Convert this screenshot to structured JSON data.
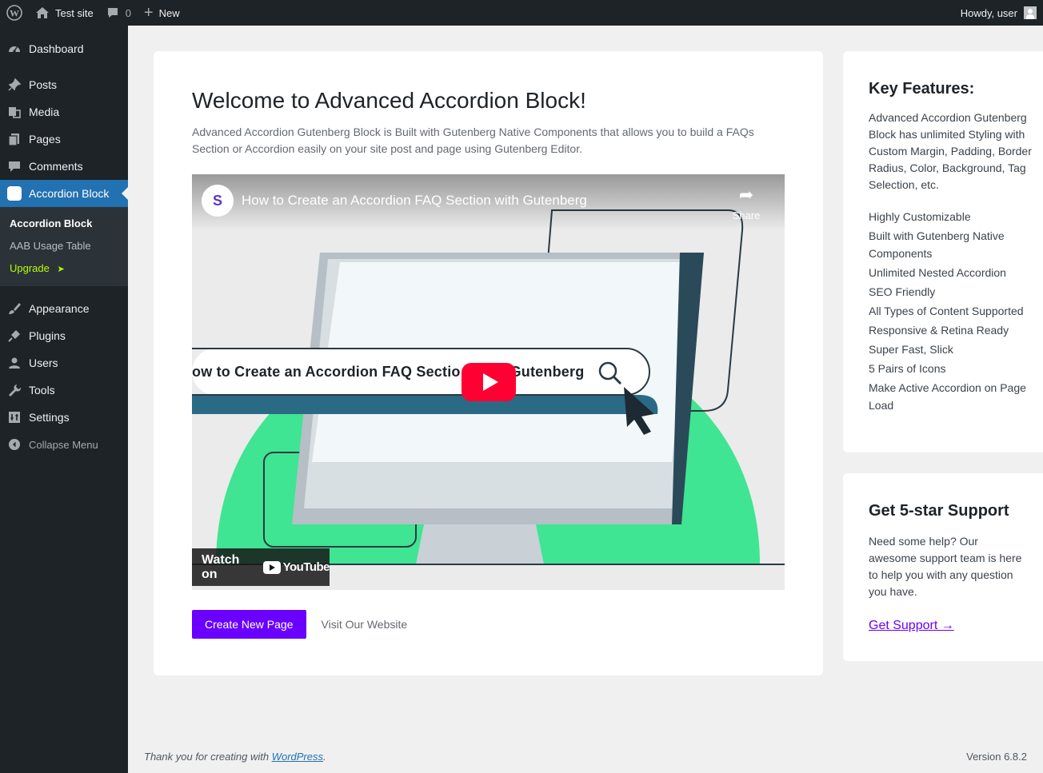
{
  "adminbar": {
    "site_name": "Test site",
    "comments_count": "0",
    "new_label": "New",
    "howdy": "Howdy, user"
  },
  "sidebar": {
    "items": [
      {
        "label": "Dashboard",
        "icon": "dashboard-icon"
      },
      {
        "label": "Posts",
        "icon": "pin-icon"
      },
      {
        "label": "Media",
        "icon": "media-icon"
      },
      {
        "label": "Pages",
        "icon": "pages-icon"
      },
      {
        "label": "Comments",
        "icon": "comment-icon"
      },
      {
        "label": "Accordion Block",
        "icon": "accordion-block-icon"
      },
      {
        "label": "Appearance",
        "icon": "brush-icon"
      },
      {
        "label": "Plugins",
        "icon": "plugin-icon"
      },
      {
        "label": "Users",
        "icon": "user-icon"
      },
      {
        "label": "Tools",
        "icon": "wrench-icon"
      },
      {
        "label": "Settings",
        "icon": "settings-icon"
      }
    ],
    "submenu": {
      "current": "Accordion Block",
      "usage": "AAB Usage Table",
      "upgrade": "Upgrade",
      "upgrade_arrow": "➤"
    },
    "collapse": "Collapse Menu"
  },
  "main": {
    "title": "Welcome to Advanced Accordion Block!",
    "description": "Advanced Accordion Gutenberg Block is Built with Gutenberg Native Components that allows you to build a FAQs Section or Accordion easily on your site post and page using Gutenberg Editor.",
    "video": {
      "channel_logo": "S",
      "title": "How to Create an Accordion FAQ Section with Gutenberg",
      "share": "Share",
      "search_text": "ow to Create an Accordion FAQ Sectio",
      "search_text_tail": "Gutenberg",
      "watch_on": "Watch on",
      "youtube": "YouTube"
    },
    "primary_button": "Create New Page",
    "secondary_link": "Visit Our Website"
  },
  "features": {
    "title": "Key Features:",
    "description": "Advanced Accordion Gutenberg Block has unlimited Styling with Custom Margin, Padding, Border Radius, Color, Background, Tag Selection, etc.",
    "items": [
      "Highly Customizable",
      "Built with Gutenberg Native Components",
      "Unlimited Nested Accordion",
      "SEO Friendly",
      "All Types of Content Supported",
      "Responsive & Retina Ready",
      "Super Fast, Slick",
      "5 Pairs of Icons",
      "Make Active Accordion on Page Load"
    ]
  },
  "support": {
    "title": "Get 5-star Support",
    "description": "Need some help? Our awesome support team is here to help you with any question you have.",
    "link": "Get Support →"
  },
  "footer": {
    "thanks_prefix": "Thank you for creating with ",
    "wordpress": "WordPress",
    "thanks_suffix": ".",
    "version": "Version 6.8.2"
  },
  "colors": {
    "admin_dark": "#1d2327",
    "admin_blue": "#2271b1",
    "brand_purple": "#6a00ff",
    "upgrade_green": "#b3ff00",
    "video_green": "#3fe592"
  }
}
